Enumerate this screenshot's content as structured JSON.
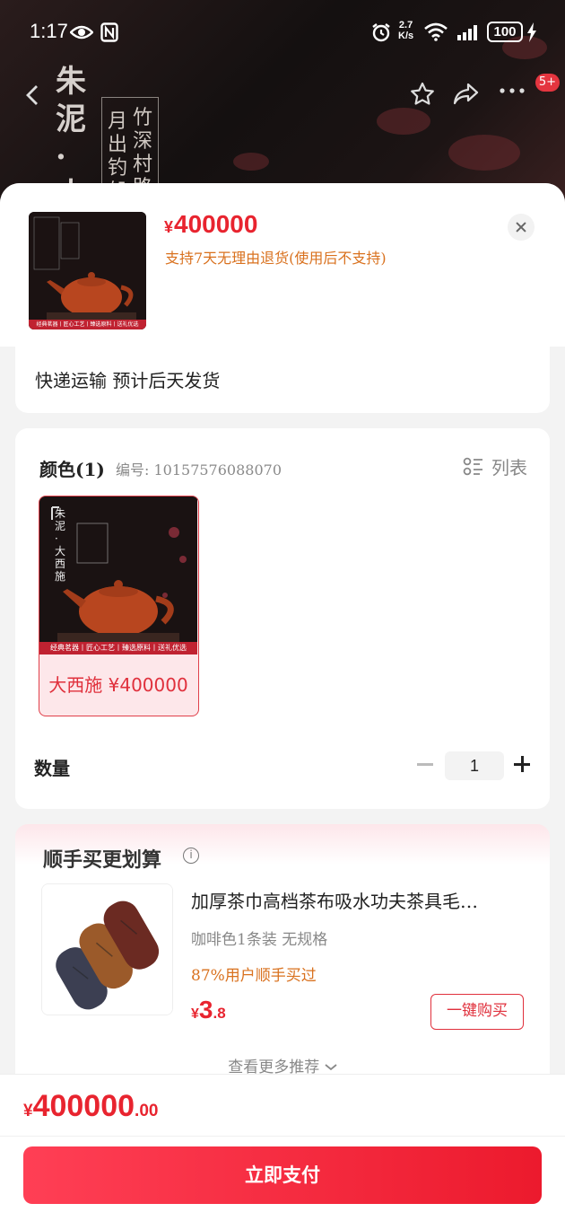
{
  "status_bar": {
    "time": "1:17",
    "net_speed_top": "2.7",
    "net_speed_unit": "K/s",
    "battery": "100"
  },
  "hero": {
    "title_chars": [
      "朱",
      "泥",
      "·",
      "大"
    ],
    "poem_col1": "竹深村路",
    "poem_col2": "月出钓船"
  },
  "header": {
    "badge": "5+"
  },
  "product": {
    "currency": "¥",
    "price": "400000",
    "return_note": "支持7天无理由退货(使用后不支持)",
    "thumb_banner": "经典茗器丨匠心工艺丨臻选原料丨送礼优选"
  },
  "shipping": {
    "text": "快递运输 预计后天发货"
  },
  "options": {
    "title": "颜色(1)",
    "code": "编号: 10157576088070",
    "list_label": "列表",
    "variant": {
      "label": "大西施 ¥400000",
      "img_title": "朱泥·大西施",
      "img_banner": "经典茗器丨匠心工艺丨臻选原料丨送礼优选"
    }
  },
  "quantity": {
    "label": "数量",
    "value": "1"
  },
  "upsell": {
    "title": "顺手买更划算",
    "name": "加厚茶巾高档茶布吸水功夫茶具毛…",
    "spec": "咖啡色1条装  无规格",
    "social": "87%用户顺手买过",
    "price_cur": "¥",
    "price_int": "3",
    "price_dec": ".8",
    "buy_label": "一键购买",
    "more_label": "查看更多推荐"
  },
  "footer": {
    "total_cur": "¥",
    "total_int": "400000",
    "total_dec": ".00",
    "pay_label": "立即支付"
  },
  "colors": {
    "accent": "#e8242f",
    "note": "#d9711e",
    "pay_gradient_start": "#ff3f55",
    "pay_gradient_end": "#ec1a2d"
  }
}
